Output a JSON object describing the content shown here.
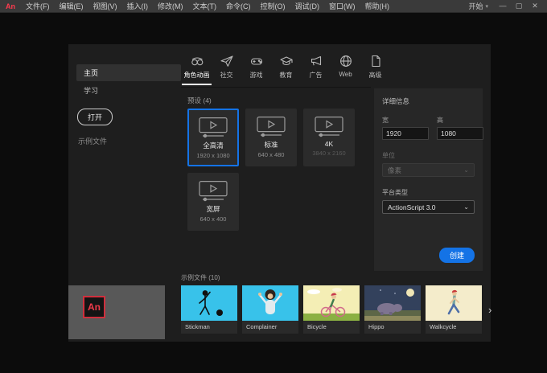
{
  "menubar": {
    "logo": "An",
    "items": [
      "文件(F)",
      "编辑(E)",
      "视图(V)",
      "插入(I)",
      "修改(M)",
      "文本(T)",
      "命令(C)",
      "控制(O)",
      "调试(D)",
      "窗口(W)",
      "帮助(H)"
    ],
    "workspace": "开始",
    "window_controls": {
      "minimize": "—",
      "maximize": "▢",
      "close": "✕"
    }
  },
  "glyphs": {
    "caret_down": "▾",
    "select_caret": "⌄",
    "chevron_right": "›"
  },
  "sidebar": {
    "home": "主页",
    "learn": "学习",
    "open_button": "打开",
    "muted_link": "示例文件"
  },
  "tabs": [
    {
      "label": "角色动画",
      "icon": "face-icon",
      "active": true
    },
    {
      "label": "社交",
      "icon": "paper-plane-icon"
    },
    {
      "label": "游戏",
      "icon": "game-controller-icon"
    },
    {
      "label": "教育",
      "icon": "graduation-cap-icon"
    },
    {
      "label": "广告",
      "icon": "megaphone-icon"
    },
    {
      "label": "Web",
      "icon": "globe-icon"
    },
    {
      "label": "高级",
      "icon": "document-icon"
    }
  ],
  "presets": {
    "header": "预设 (4)",
    "cards": [
      {
        "name": "全高清",
        "size": "1920 x 1080",
        "selected": true
      },
      {
        "name": "标准",
        "size": "640 x 480"
      },
      {
        "name": "4K",
        "size": "3840 x 2160"
      },
      {
        "name": "宽屏",
        "size": "640 x 400"
      }
    ]
  },
  "details": {
    "title": "详细信息",
    "width_label": "宽",
    "width_value": "1920",
    "height_label": "高",
    "height_value": "1080",
    "units_label": "单位",
    "units_value": "像素",
    "platform_label": "平台类型",
    "platform_value": "ActionScript 3.0",
    "create_button": "创建"
  },
  "samples": {
    "header": "示例文件 (10)",
    "items": [
      {
        "name": "Stickman"
      },
      {
        "name": "Complainer"
      },
      {
        "name": "Bicycle"
      },
      {
        "name": "Hippo"
      },
      {
        "name": "Walkcycle"
      }
    ]
  },
  "branding": {
    "logo_text": "An"
  },
  "colors": {
    "accent_blue": "#1473e6",
    "logo_red": "#ef3a4a",
    "menubar_bg": "#3a3a3a",
    "panel_bg": "#1e1e1e",
    "details_bg": "#272727",
    "card_bg": "#2b2b2b",
    "thumb_cyan": "#38c2ea",
    "thumb_cream": "#f4eccb",
    "thumb_night": "#33415c"
  }
}
